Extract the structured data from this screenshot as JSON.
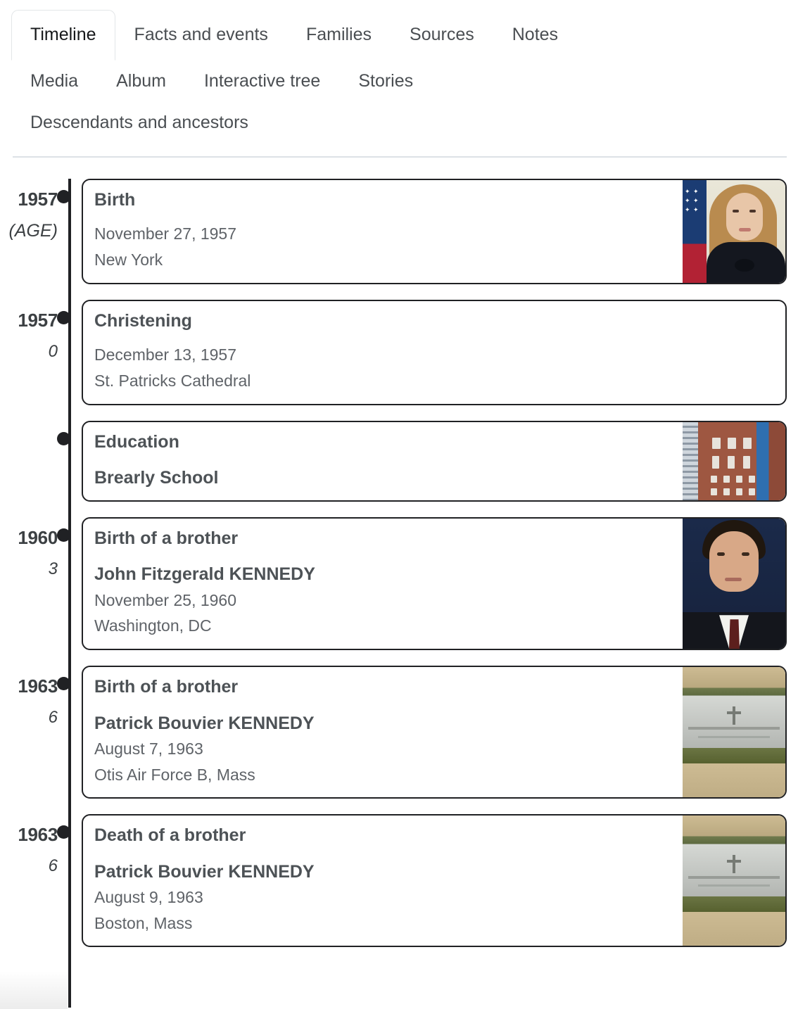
{
  "nav": {
    "rows": [
      [
        {
          "label": "Timeline",
          "active": true
        },
        {
          "label": "Facts and events",
          "active": false
        },
        {
          "label": "Families",
          "active": false
        },
        {
          "label": "Sources",
          "active": false
        },
        {
          "label": "Notes",
          "active": false
        }
      ],
      [
        {
          "label": "Media",
          "active": false
        },
        {
          "label": "Album",
          "active": false
        },
        {
          "label": "Interactive tree",
          "active": false
        },
        {
          "label": "Stories",
          "active": false
        }
      ],
      [
        {
          "label": "Descendants and ancestors",
          "active": false
        }
      ]
    ]
  },
  "timeline": {
    "events": [
      {
        "year": "1957",
        "age": "(AGE)",
        "age_italic": true,
        "title": "Birth",
        "person": "",
        "date": "November 27, 1957",
        "place": "New York",
        "photo": "caroline-kennedy-portrait-photo",
        "has_photo": true
      },
      {
        "year": "1957",
        "age": "0",
        "age_italic": true,
        "title": "Christening",
        "person": "",
        "date": "December 13, 1957",
        "place": "St. Patricks Cathedral",
        "photo": "",
        "has_photo": false
      },
      {
        "year": "",
        "age": "",
        "age_italic": false,
        "title": "Education",
        "person": "Brearly School",
        "date": "",
        "place": "",
        "photo": "brearley-school-building-photo",
        "has_photo": true
      },
      {
        "year": "1960",
        "age": "3",
        "age_italic": true,
        "title": "Birth of a brother",
        "person": "John Fitzgerald KENNEDY",
        "date": "November 25, 1960",
        "place": "Washington, DC",
        "photo": "john-f-kennedy-jr-portrait-photo",
        "has_photo": true
      },
      {
        "year": "1963",
        "age": "6",
        "age_italic": true,
        "title": "Birth of a brother",
        "person": "Patrick Bouvier KENNEDY",
        "date": "August 7, 1963",
        "place": "Otis Air Force B, Mass",
        "photo": "patrick-bouvier-kennedy-grave-photo",
        "has_photo": true
      },
      {
        "year": "1963",
        "age": "6",
        "age_italic": true,
        "title": "Death of a brother",
        "person": "Patrick Bouvier KENNEDY",
        "date": "August 9, 1963",
        "place": "Boston, Mass",
        "photo": "patrick-bouvier-kennedy-grave-photo",
        "has_photo": true
      }
    ]
  },
  "colors": {
    "axis": "#202124",
    "card_border": "#202124",
    "text": "#3c4043",
    "muted_text": "#5f6368",
    "divider": "#dde1e6",
    "active_tab_border": "#e3e6e8"
  }
}
